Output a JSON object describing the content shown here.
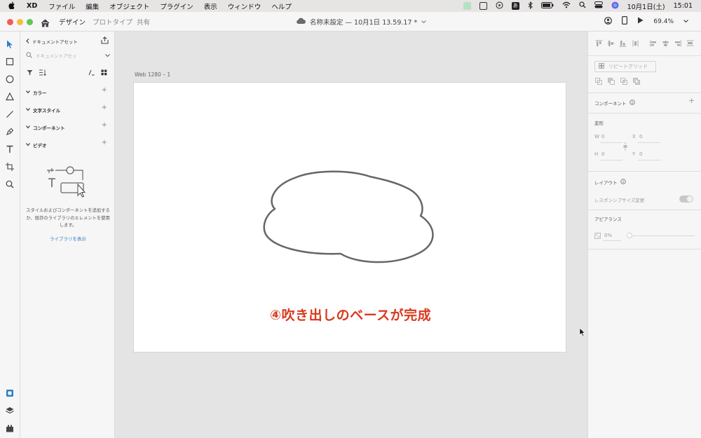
{
  "menubar": {
    "app_name": "XD",
    "items": [
      "ファイル",
      "編集",
      "オブジェクト",
      "プラグイン",
      "表示",
      "ウィンドウ",
      "ヘルプ"
    ],
    "date": "10月1日(土)",
    "time": "15:01"
  },
  "titlebar": {
    "tabs": [
      {
        "label": "デザイン",
        "active": true
      },
      {
        "label": "プロトタイプ",
        "active": false
      },
      {
        "label": "共有",
        "active": false
      }
    ],
    "doc_title": "名称未設定 — 10月1日 13.59.17 *",
    "zoom": "69.4%"
  },
  "assets": {
    "header": "ドキュメントアセット",
    "search_placeholder": "ドキュメントアセッ",
    "sections": [
      {
        "label": "カラー"
      },
      {
        "label": "文字スタイル"
      },
      {
        "label": "コンポーネント"
      },
      {
        "label": "ビデオ"
      }
    ],
    "empty_text": "スタイルおよびコンポーネントを追加するか、既存のライブラリのエレメントを使用します。",
    "library_button": "ライブラリを表示"
  },
  "canvas": {
    "artboard_label": "Web 1280 – 1",
    "caption": "④吹き出しのベースが完成"
  },
  "props": {
    "repeat_grid": "リピートグリッド",
    "component": "コンポーネント",
    "transform": "変形",
    "w_label": "W",
    "w_value": "0",
    "x_label": "X",
    "x_value": "0",
    "h_label": "H",
    "h_value": "0",
    "y_label": "Y",
    "y_value": "0",
    "layout": "レイアウト",
    "responsive": "レスポンシブサイズ変更",
    "appearance": "アピアランス",
    "opacity": "0%"
  },
  "colors": {
    "accent": "#2d7ec4",
    "caption": "#d83a1d",
    "close": "#ee5f57",
    "minimize": "#f6bd3f",
    "zoom": "#5fc84d"
  }
}
